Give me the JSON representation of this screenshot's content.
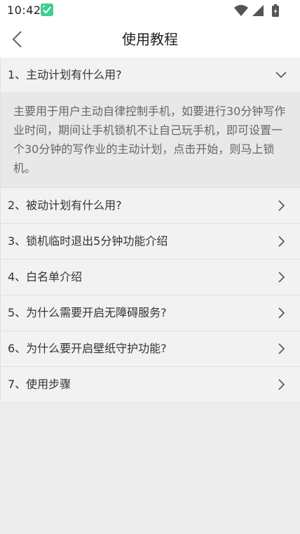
{
  "status_bar": {
    "time": "10:42",
    "app_icon": "check-shield-icon",
    "indicators": [
      "wifi-icon",
      "signal-icon",
      "battery-icon"
    ]
  },
  "nav": {
    "back_icon": "back-arrow-icon",
    "title": "使用教程"
  },
  "faq": [
    {
      "question": "1、主动计划有什么用?",
      "expanded": true,
      "answer": "主要用于用户主动自律控制手机，如要进行30分钟写作业时间，期间让手机锁机不让自己玩手机，即可设置一个30分钟的写作业的主动计划，点击开始，则马上锁机。"
    },
    {
      "question": "2、被动计划有什么用?",
      "expanded": false
    },
    {
      "question": "3、锁机临时退出5分钟功能介绍",
      "expanded": false
    },
    {
      "question": "4、白名单介绍",
      "expanded": false
    },
    {
      "question": "5、为什么需要开启无障碍服务?",
      "expanded": false
    },
    {
      "question": "6、为什么要开启壁纸守护功能?",
      "expanded": false
    },
    {
      "question": "7、使用步骤",
      "expanded": false
    }
  ],
  "colors": {
    "app_icon_green": "#3fcf8e",
    "page_background": "#ececec",
    "row_background": "#f2f2f2",
    "answer_background": "#e8e8e8"
  }
}
